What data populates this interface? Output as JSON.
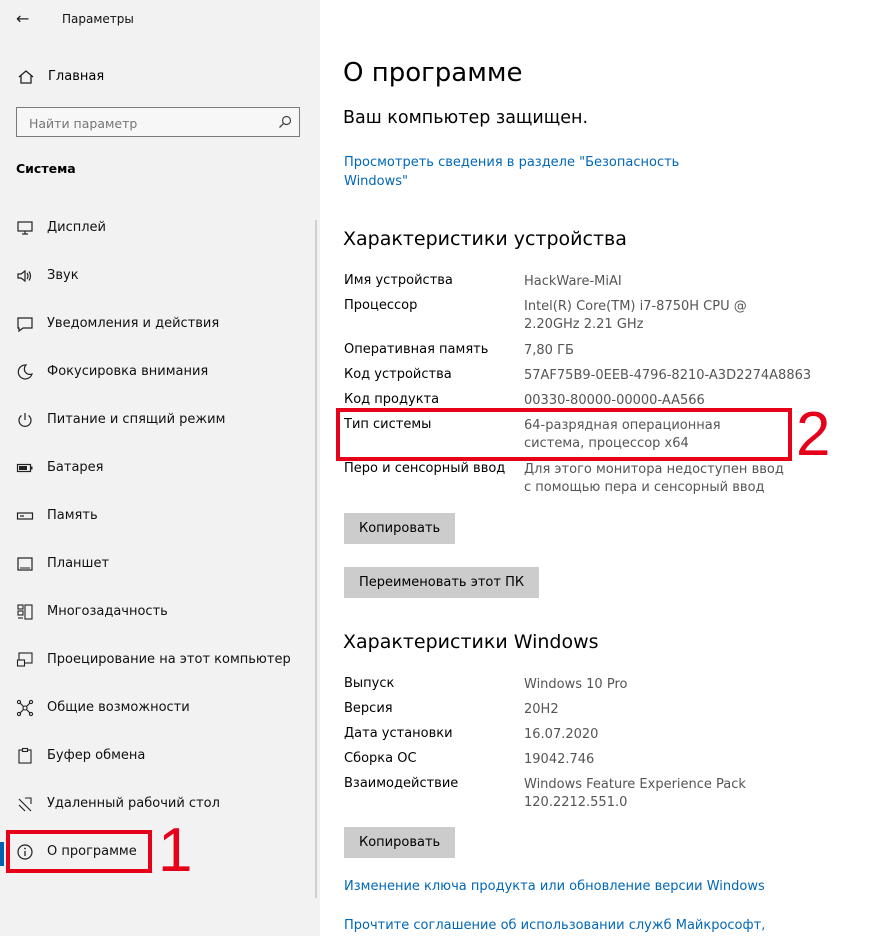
{
  "window": {
    "title": "Параметры"
  },
  "sidebar": {
    "home_label": "Главная",
    "search_placeholder": "Найти параметр",
    "section_title": "Система",
    "items": [
      {
        "label": "Дисплей",
        "icon": "display-icon"
      },
      {
        "label": "Звук",
        "icon": "sound-icon"
      },
      {
        "label": "Уведомления и действия",
        "icon": "notifications-icon"
      },
      {
        "label": "Фокусировка внимания",
        "icon": "focus-assist-icon"
      },
      {
        "label": "Питание и спящий режим",
        "icon": "power-icon"
      },
      {
        "label": "Батарея",
        "icon": "battery-icon"
      },
      {
        "label": "Память",
        "icon": "storage-icon"
      },
      {
        "label": "Планшет",
        "icon": "tablet-icon"
      },
      {
        "label": "Многозадачность",
        "icon": "multitasking-icon"
      },
      {
        "label": "Проецирование на этот компьютер",
        "icon": "projecting-icon"
      },
      {
        "label": "Общие возможности",
        "icon": "shared-experiences-icon"
      },
      {
        "label": "Буфер обмена",
        "icon": "clipboard-icon"
      },
      {
        "label": "Удаленный рабочий стол",
        "icon": "remote-desktop-icon"
      },
      {
        "label": "О программе",
        "icon": "info-icon",
        "active": true
      }
    ]
  },
  "annotations": {
    "label_1": "1",
    "label_2": "2",
    "color": "#e6001a"
  },
  "main": {
    "title": "О программе",
    "protection_status": "Ваш компьютер защищен.",
    "security_link": "Просмотреть сведения в разделе \"Безопасность Windows\"",
    "device_specs": {
      "heading": "Характеристики устройства",
      "rows": [
        {
          "label": "Имя устройства",
          "value": "HackWare-MiAI"
        },
        {
          "label": "Процессор",
          "value": "Intel(R) Core(TM) i7-8750H CPU @ 2.20GHz 2.21 GHz"
        },
        {
          "label": "Оперативная память",
          "value": "7,80 ГБ"
        },
        {
          "label": "Код устройства",
          "value": "57AF75B9-0EEB-4796-8210-A3D2274A8863"
        },
        {
          "label": "Код продукта",
          "value": "00330-80000-00000-AA566"
        },
        {
          "label": "Тип системы",
          "value": "64-разрядная операционная система, процессор x64"
        },
        {
          "label": "Перо и сенсорный ввод",
          "value": "Для этого монитора недоступен ввод с помощью пера и сенсорный ввод"
        }
      ],
      "copy_button": "Копировать",
      "rename_button": "Переименовать этот ПК"
    },
    "windows_specs": {
      "heading": "Характеристики Windows",
      "rows": [
        {
          "label": "Выпуск",
          "value": "Windows 10 Pro"
        },
        {
          "label": "Версия",
          "value": "20H2"
        },
        {
          "label": "Дата установки",
          "value": "16.07.2020"
        },
        {
          "label": "Сборка ОС",
          "value": "19042.746"
        },
        {
          "label": "Взаимодействие",
          "value": "Windows Feature Experience Pack 120.2212.551.0"
        }
      ],
      "copy_button": "Копировать"
    },
    "links": {
      "change_key": "Изменение ключа продукта или обновление версии Windows",
      "agreement": "Прочтите соглашение об использовании служб Майкрософт,"
    }
  },
  "colors": {
    "accent": "#0063b1",
    "link": "#0067b8",
    "sidebar_bg": "#f2f2f2",
    "button_bg": "#cccccc"
  }
}
